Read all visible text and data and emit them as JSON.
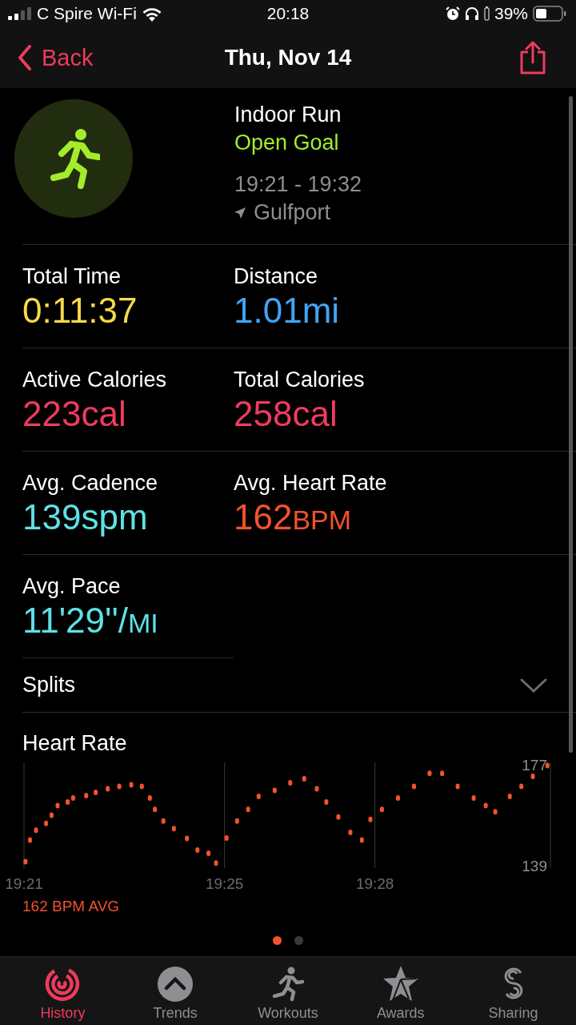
{
  "status_bar": {
    "carrier": "C Spire Wi-Fi",
    "time": "20:18",
    "battery": "39%"
  },
  "nav": {
    "back": "Back",
    "title": "Thu, Nov 14"
  },
  "workout": {
    "name": "Indoor Run",
    "goal": "Open Goal",
    "time_range": "19:21 - 19:32",
    "location": "Gulfport"
  },
  "metrics": [
    {
      "label": "Total Time",
      "value": "0:11:37",
      "color": "#f7da4a"
    },
    {
      "label": "Distance",
      "value": "1.01mi",
      "color": "#42a5f5"
    },
    {
      "label": "Active Calories",
      "value": "223cal",
      "color": "#ef3b5f"
    },
    {
      "label": "Total Calories",
      "value": "258cal",
      "color": "#ef3b5f"
    },
    {
      "label": "Avg. Cadence",
      "value": "139spm",
      "color": "#5fe1e6"
    },
    {
      "label": "Avg. Heart Rate",
      "value": "162",
      "unit": "BPM",
      "color": "#f3522f"
    },
    {
      "label": "Avg. Pace",
      "value": "11'29''/",
      "unit": "MI",
      "color": "#5fe1e6"
    }
  ],
  "splits": {
    "label": "Splits",
    "expanded": false
  },
  "heart_rate": {
    "average": "162 BPM AVG",
    "chart_data": {
      "type": "scatter",
      "title": "Heart Rate",
      "ylim": [
        138,
        178
      ],
      "yticks": [
        139,
        177
      ],
      "xlim": [
        1161,
        1171.5
      ],
      "xticks": [
        {
          "value": 1161,
          "label": "19:21"
        },
        {
          "value": 1165,
          "label": "19:25"
        },
        {
          "value": 1168,
          "label": "19:28"
        }
      ],
      "series": [
        {
          "color": "#f3522f",
          "x": [
            1161.03,
            1161.12,
            1161.24,
            1161.44,
            1161.55,
            1161.67,
            1161.87,
            1161.98,
            1162.24,
            1162.43,
            1162.67,
            1162.9,
            1163.14,
            1163.35,
            1163.51,
            1163.61,
            1163.78,
            1163.99,
            1164.25,
            1164.46,
            1164.68,
            1164.83,
            1165.04,
            1165.25,
            1165.47,
            1165.68,
            1166.0,
            1166.31,
            1166.59,
            1166.84,
            1167.03,
            1167.27,
            1167.51,
            1167.74,
            1167.91,
            1168.14,
            1168.46,
            1168.78,
            1169.09,
            1169.34,
            1169.65,
            1169.97,
            1170.21,
            1170.4,
            1170.69,
            1170.92,
            1171.15,
            1171.44
          ],
          "values": [
            140.4,
            148.6,
            152.3,
            154.9,
            158,
            161.6,
            163,
            164.5,
            165.4,
            166.6,
            168,
            168.9,
            169.5,
            168.9,
            164.5,
            160.2,
            155.8,
            152.9,
            149.2,
            144.8,
            143.6,
            139.9,
            149.4,
            155.8,
            160.2,
            165.1,
            167.4,
            170.3,
            171.8,
            168,
            163,
            157.3,
            151.5,
            148.6,
            156.4,
            160.2,
            164.5,
            168.9,
            173.8,
            173.8,
            168.9,
            164.5,
            161.6,
            159.3,
            165.1,
            168.9,
            172.7,
            176.8
          ]
        }
      ]
    }
  },
  "page_dots": [
    {
      "selected": true
    },
    {
      "selected": false
    }
  ],
  "tabs": [
    {
      "label": "History",
      "selected": true
    },
    {
      "label": "Trends",
      "selected": false
    },
    {
      "label": "Workouts",
      "selected": false
    },
    {
      "label": "Awards",
      "selected": false
    },
    {
      "label": "Sharing",
      "selected": false
    }
  ]
}
